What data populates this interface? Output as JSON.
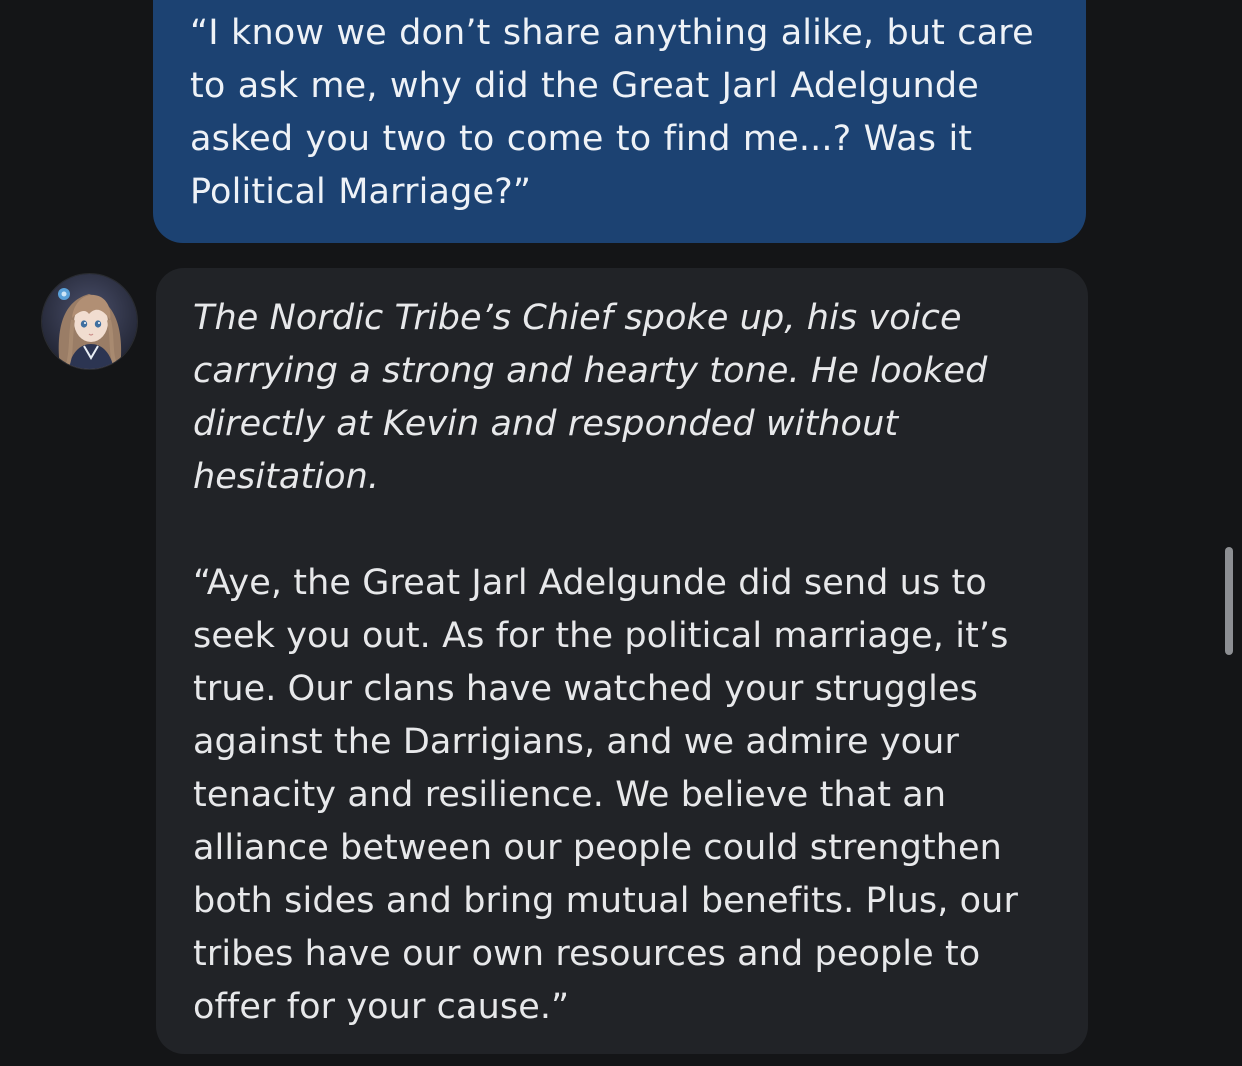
{
  "messages": {
    "user": {
      "text": "“I know we don’t share anything alike, but care to ask me, why did the Great Jarl Adelgunde asked you two to come to find me...? Was it Political Marriage?”"
    },
    "bot": {
      "avatar_icon": "character-portrait-avatar",
      "action": "The Nordic Tribe’s Chief spoke up, his voice carrying a strong and hearty tone. He looked directly at Kevin and responded without hesitation.",
      "speech": "“Aye, the Great Jarl Adelgunde did send us to seek you out. As for the political marriage, it’s true. Our clans have watched your struggles against the Darrigians, and we admire your tenacity and resilience. We believe that an alliance between our people could strengthen both sides and bring mutual benefits. Plus, our tribes have our own resources and people to offer for your cause.”"
    }
  },
  "colors": {
    "background": "#141517",
    "user_bubble": "#1c4272",
    "bot_bubble": "#212327",
    "text": "#e7e8ea",
    "scrollbar": "#8d8f93"
  }
}
